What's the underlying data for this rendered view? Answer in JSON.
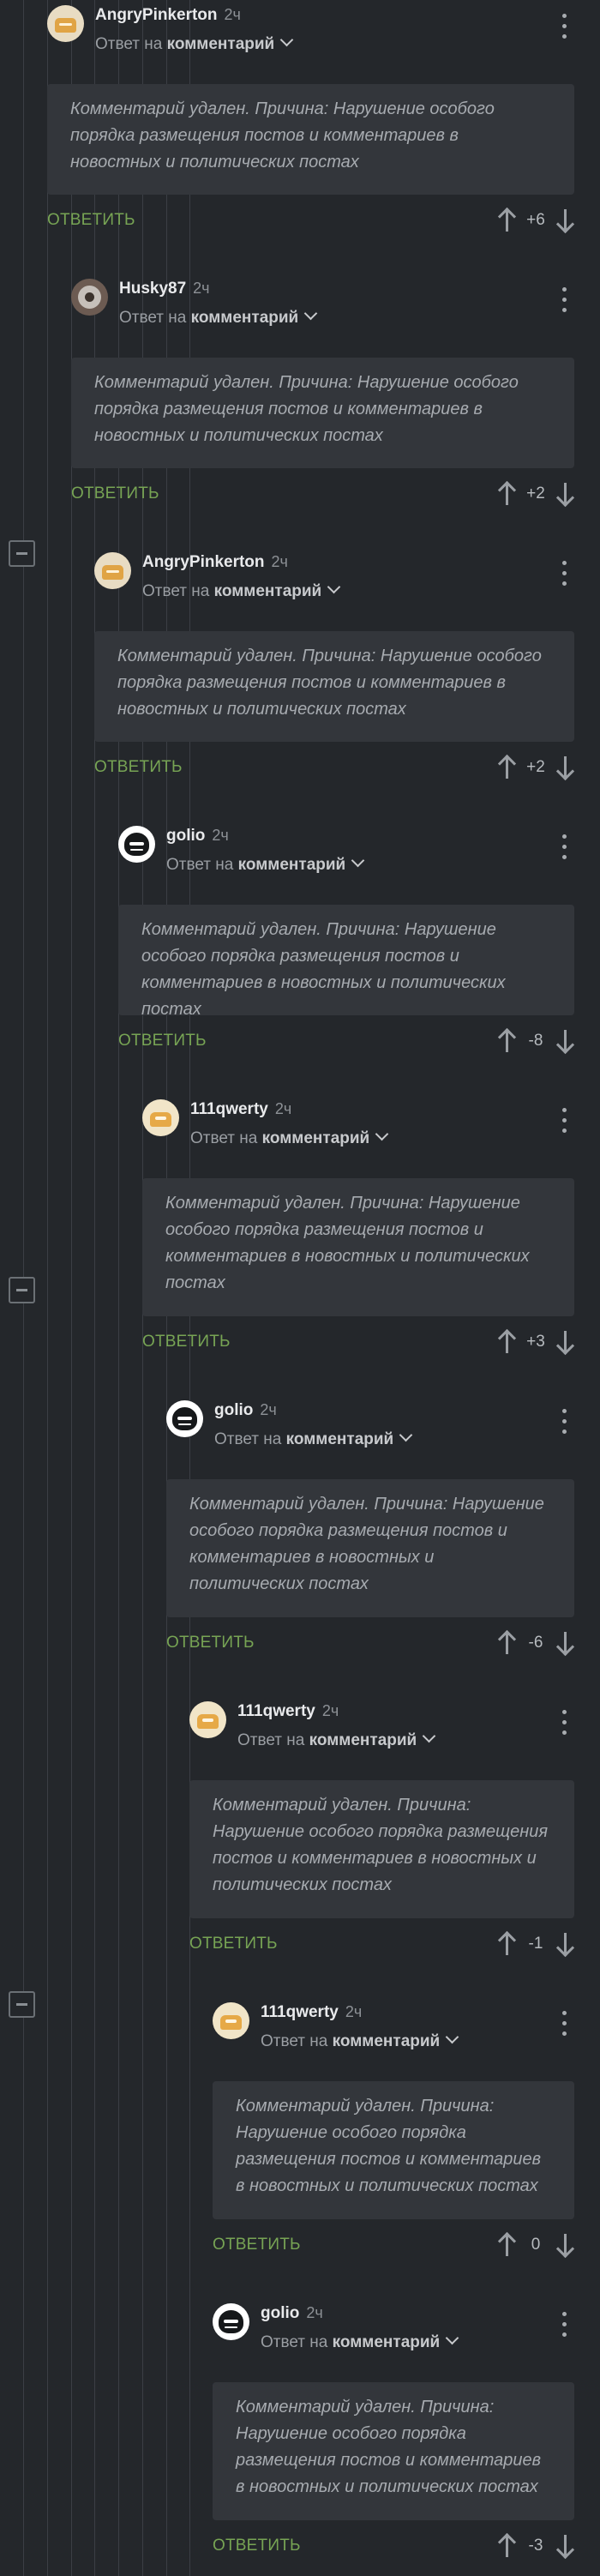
{
  "reply_prefix": "Ответ на",
  "reply_target": "комментарий",
  "reply_button_label": "ОТВЕТИТЬ",
  "colors": {
    "background": "#24272b",
    "card": "#33363b",
    "accent": "#77a454",
    "text": "#e9eaec"
  },
  "comments": [
    {
      "author": "AngryPinkerton",
      "time": "2ч",
      "avatar": "angry-pinkerton-avatar",
      "text": "Комментарий удален. Причина: Нарушение особого порядка размещения постов и комментариев в новостных и политических постах",
      "score": "+6"
    },
    {
      "author": "Husky87",
      "time": "2ч",
      "avatar": "husky-avatar",
      "text": "Комментарий удален. Причина: Нарушение особого порядка размещения постов и комментариев в новостных и политических постах",
      "score": "+2"
    },
    {
      "author": "AngryPinkerton",
      "time": "2ч",
      "avatar": "angry-pinkerton-avatar",
      "text": "Комментарий удален. Причина: Нарушение особого порядка размещения постов и комментариев в новостных и политических постах",
      "score": "+2"
    },
    {
      "author": "golio",
      "time": "2ч",
      "avatar": "golio-avatar",
      "text": "Комментарий удален. Причина: Нарушение особого порядка размещения постов и комментариев в новостных и политических постах",
      "score": "-8"
    },
    {
      "author": "111qwerty",
      "time": "2ч",
      "avatar": "qwerty-avatar",
      "text": "Комментарий удален. Причина: Нарушение особого порядка размещения постов и комментариев в новостных и политических постах",
      "score": "+3"
    },
    {
      "author": "golio",
      "time": "2ч",
      "avatar": "golio-avatar",
      "text": "Комментарий удален. Причина: Нарушение особого порядка размещения постов и комментариев в новостных и политических постах",
      "score": "-6"
    },
    {
      "author": "111qwerty",
      "time": "2ч",
      "avatar": "qwerty-avatar",
      "text": "Комментарий удален. Причина: Нарушение особого порядка размещения постов и комментариев в новостных и политических постах",
      "score": "-1"
    },
    {
      "author": "111qwerty",
      "time": "2ч",
      "avatar": "qwerty-avatar",
      "text": "Комментарий удален. Причина: Нарушение особого порядка размещения постов и комментариев в новостных и политических постах",
      "score": "0"
    },
    {
      "author": "golio",
      "time": "2ч",
      "avatar": "golio-avatar",
      "text": "Комментарий удален. Причина: Нарушение особого порядка размещения постов и комментариев в новостных и политических постах",
      "score": "-3"
    }
  ]
}
